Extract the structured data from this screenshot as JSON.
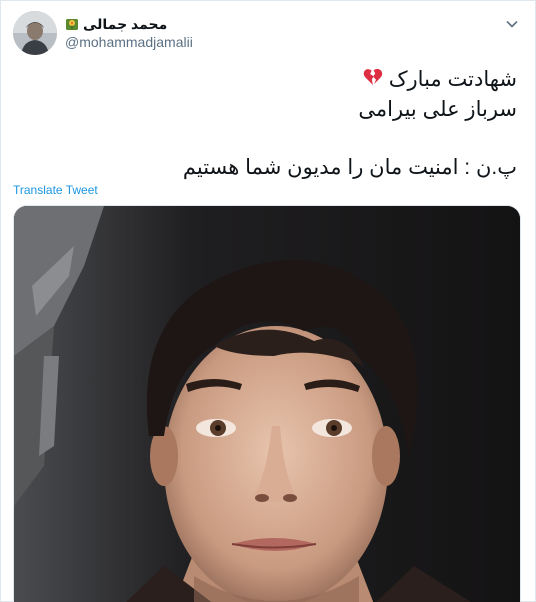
{
  "author": {
    "display_name": "محمد جمالی",
    "handle": "@mohammadjamalii",
    "badge_icon": "blossom-emoji-icon"
  },
  "menu": {
    "icon": "chevron-down-icon"
  },
  "tweet": {
    "line1": "شهادتت مبارک",
    "line1_icon": "broken-heart-icon",
    "line2": "سرباز علی بیرامی",
    "line3": "پ.ن : امنیت مان را مدیون شما هستیم"
  },
  "translate_label": "Translate Tweet",
  "colors": {
    "link": "#1b95e0",
    "secondary_text": "#5b7083",
    "broken_heart": "#dd2e44"
  }
}
